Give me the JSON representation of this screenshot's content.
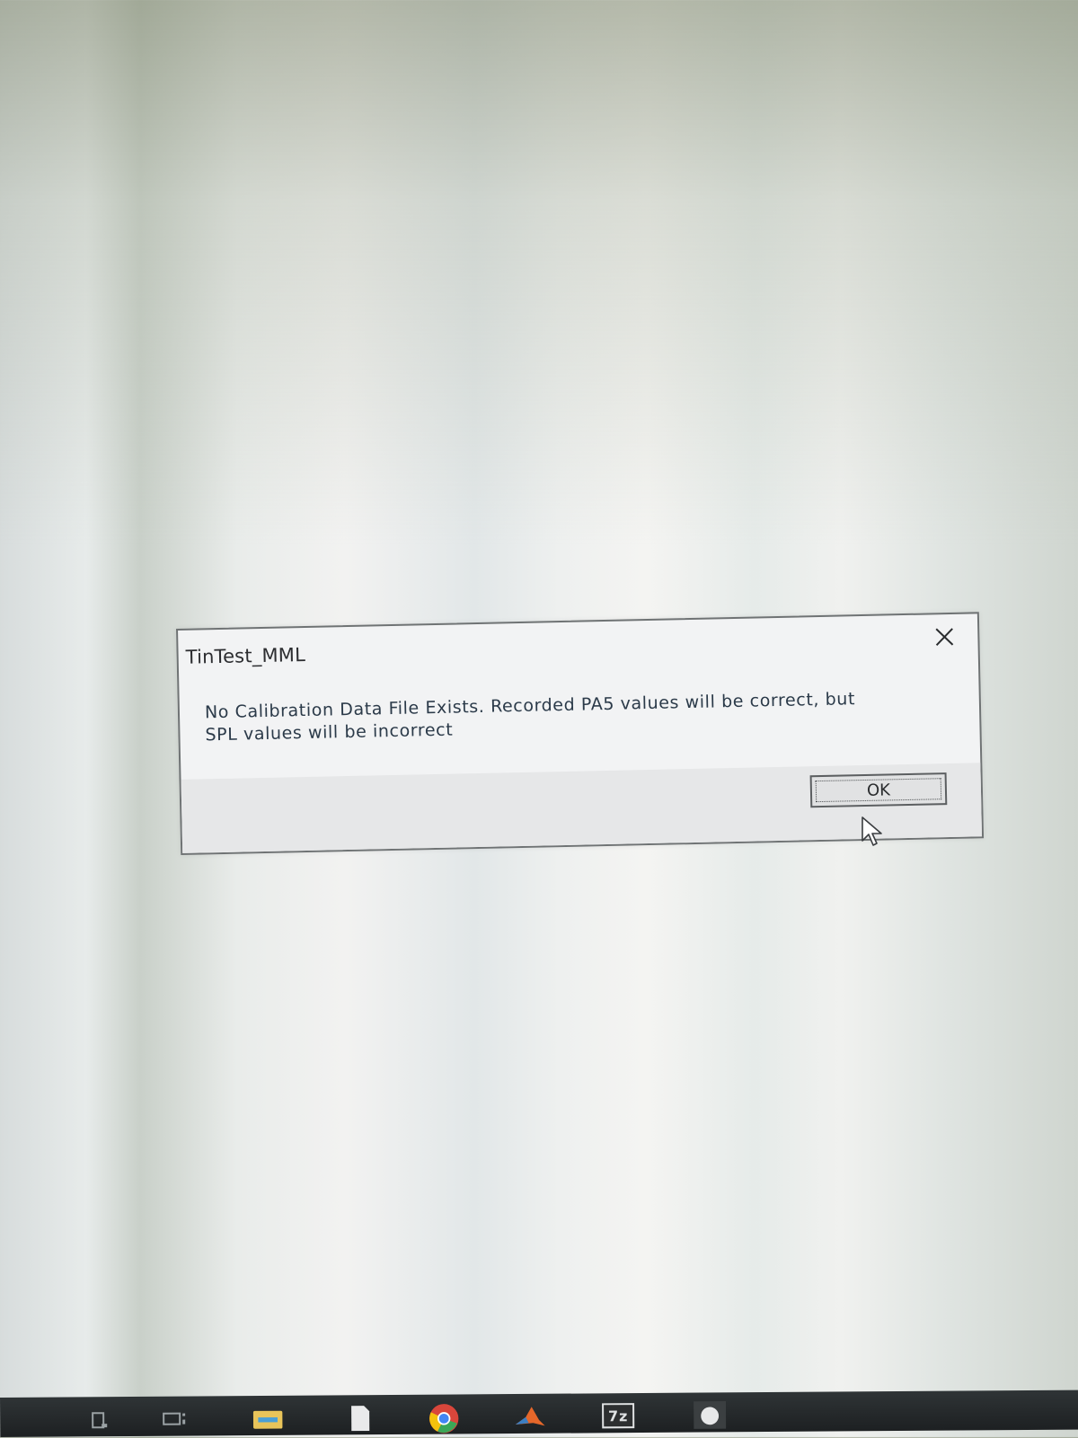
{
  "dialog": {
    "title": "TinTest_MML",
    "message_line1": "No Calibration Data File Exists.  Recorded PA5 values will be correct, but",
    "message_line2": "SPL values will be incorrect",
    "ok_label": "OK",
    "close_icon": "close-icon"
  },
  "taskbar": {
    "icons": [
      "file-icon",
      "task-view-icon",
      "file-explorer-icon",
      "document-icon",
      "chrome-icon",
      "matlab-icon",
      "7zip-icon",
      "app-icon"
    ],
    "sevenzip_label": "7z"
  },
  "colors": {
    "dialog_bg": "#f2f3f4",
    "dialog_border": "#6f7374",
    "message_text": "#2b3a49",
    "taskbar_bg": "#1d2022"
  }
}
